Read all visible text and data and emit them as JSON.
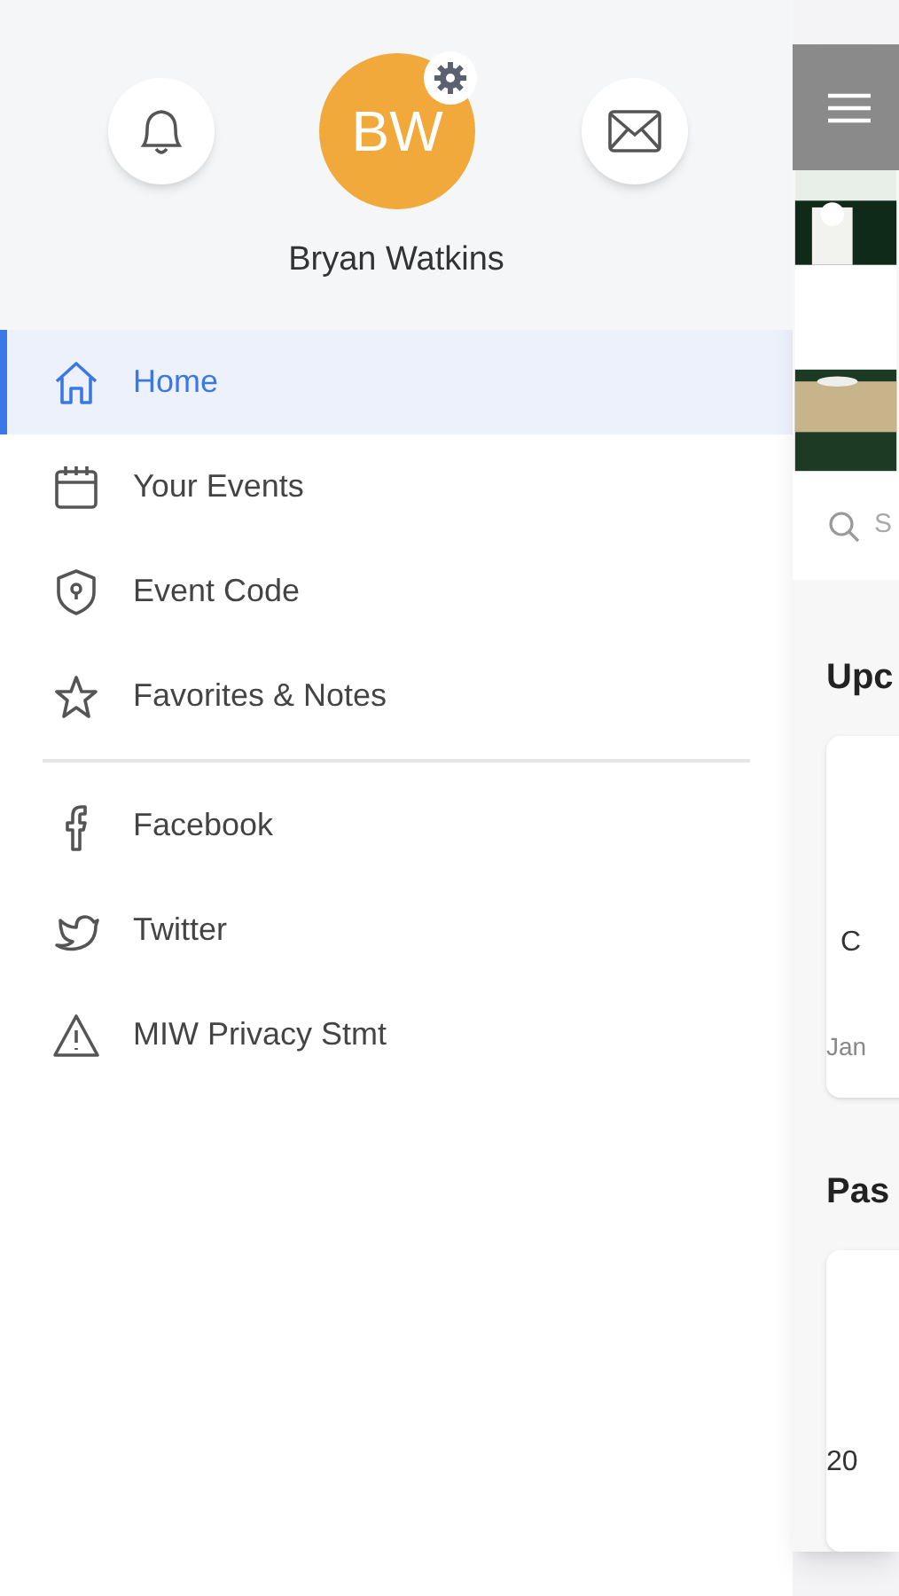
{
  "drawer": {
    "profile": {
      "initials": "BW",
      "name": "Bryan Watkins"
    },
    "menu_groups": [
      [
        {
          "kind": "home",
          "label": "Home",
          "selected": true
        },
        {
          "kind": "calendar",
          "label": "Your Events",
          "selected": false
        },
        {
          "kind": "shield",
          "label": "Event Code",
          "selected": false
        },
        {
          "kind": "star",
          "label": "Favorites & Notes",
          "selected": false
        }
      ],
      [
        {
          "kind": "facebook",
          "label": "Facebook",
          "selected": false
        },
        {
          "kind": "twitter",
          "label": "Twitter",
          "selected": false
        },
        {
          "kind": "warning",
          "label": "MIW Privacy Stmt",
          "selected": false
        }
      ]
    ]
  },
  "main_screen": {
    "search": {
      "placeholder": "S"
    },
    "sections": [
      {
        "heading": "Upc",
        "card_texts": [
          "C",
          "Jan"
        ]
      },
      {
        "heading": "Pas",
        "card_texts": [
          "20"
        ]
      }
    ]
  }
}
